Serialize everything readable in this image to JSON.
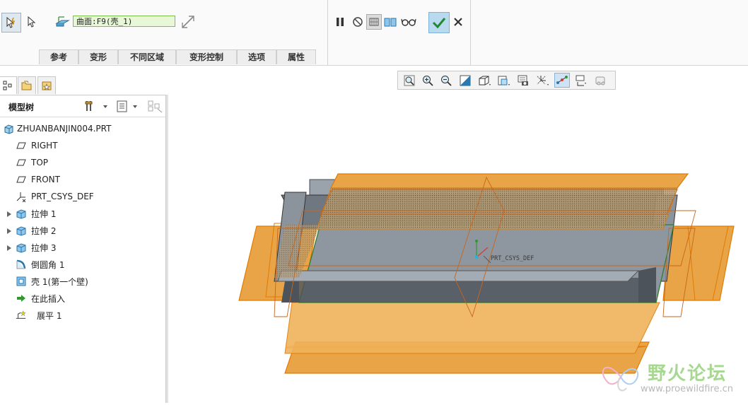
{
  "ribbon": {
    "reference_field": "曲面:F9(壳_1)",
    "tabs": [
      "参考",
      "变形",
      "不同区域",
      "变形控制",
      "选项",
      "属性"
    ]
  },
  "model_tree": {
    "title": "模型树",
    "items": [
      {
        "label": "ZHUANBANJIN004.PRT",
        "icon": "part-icon",
        "expandable": false
      },
      {
        "label": "RIGHT",
        "icon": "datum-plane-icon",
        "expandable": false
      },
      {
        "label": "TOP",
        "icon": "datum-plane-icon",
        "expandable": false
      },
      {
        "label": "FRONT",
        "icon": "datum-plane-icon",
        "expandable": false
      },
      {
        "label": "PRT_CSYS_DEF",
        "icon": "csys-icon",
        "expandable": false
      },
      {
        "label": "拉伸 1",
        "icon": "extrude-icon",
        "expandable": true
      },
      {
        "label": "拉伸 2",
        "icon": "extrude-icon",
        "expandable": true
      },
      {
        "label": "拉伸 3",
        "icon": "extrude-icon",
        "expandable": true
      },
      {
        "label": "倒圆角 1",
        "icon": "round-icon",
        "expandable": false
      },
      {
        "label": "壳 1(第一个壁)",
        "icon": "shell-icon",
        "expandable": false
      },
      {
        "label": "在此插入",
        "icon": "insert-here-icon",
        "expandable": false
      },
      {
        "label": "展平 1",
        "icon": "flatten-icon",
        "expandable": false
      }
    ]
  },
  "viewport": {
    "csys_label": "PRT_CSYS_DEF",
    "colors": {
      "surface_fill": "#f0a23a",
      "solid": "#8a929c",
      "edge": "#4caf50"
    }
  },
  "watermark": {
    "text": "野火论坛",
    "url": "www.proewildfire.cn"
  }
}
